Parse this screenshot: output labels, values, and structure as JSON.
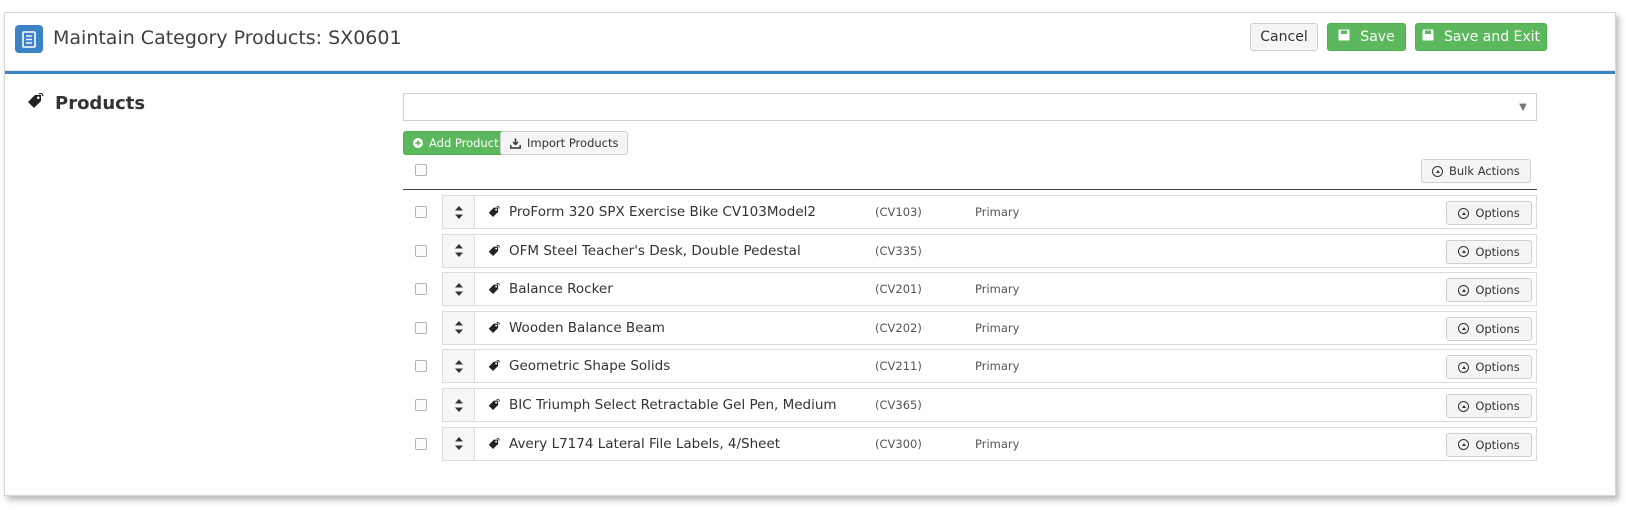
{
  "header": {
    "title": "Maintain Category Products: SX0601",
    "icon": "document-icon",
    "cancel_label": "Cancel",
    "save_label": "Save",
    "save_exit_label": "Save and Exit"
  },
  "section": {
    "title": "Products",
    "icon": "tag-icon"
  },
  "search": {
    "value": ""
  },
  "toolbar": {
    "add_label": "Add Product",
    "import_label": "Import Products",
    "bulk_label": "Bulk Actions"
  },
  "products": [
    {
      "name": "ProForm 320 SPX Exercise Bike CV103Model2",
      "code": "(CV103)",
      "status": "Primary",
      "options_label": "Options"
    },
    {
      "name": "OFM Steel Teacher's Desk, Double Pedestal",
      "code": "(CV335)",
      "status": "",
      "options_label": "Options"
    },
    {
      "name": "Balance Rocker",
      "code": "(CV201)",
      "status": "Primary",
      "options_label": "Options"
    },
    {
      "name": "Wooden Balance Beam",
      "code": "(CV202)",
      "status": "Primary",
      "options_label": "Options"
    },
    {
      "name": "Geometric Shape Solids",
      "code": "(CV211)",
      "status": "Primary",
      "options_label": "Options"
    },
    {
      "name": "BIC Triumph Select Retractable Gel Pen, Medium",
      "code": "(CV365)",
      "status": "",
      "options_label": "Options"
    },
    {
      "name": "Avery L7174 Lateral File Labels, 4/Sheet",
      "code": "(CV300)",
      "status": "Primary",
      "options_label": "Options"
    }
  ],
  "colors": {
    "accent": "#3b83c6",
    "green": "#5cb85c"
  }
}
